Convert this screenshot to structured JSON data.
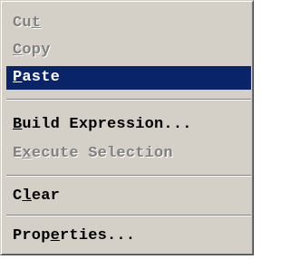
{
  "menu": {
    "items": [
      {
        "pre": "Cu",
        "key": "t",
        "post": "",
        "state": "disabled"
      },
      {
        "pre": "",
        "key": "C",
        "post": "opy",
        "state": "disabled"
      },
      {
        "pre": "",
        "key": "P",
        "post": "aste",
        "state": "highlighted"
      },
      {
        "pre": "",
        "key": "B",
        "post": "uild Expression...",
        "state": "enabled"
      },
      {
        "pre": "E",
        "key": "x",
        "post": "ecute Selection",
        "state": "disabled"
      },
      {
        "pre": "C",
        "key": "l",
        "post": "ear",
        "state": "enabled"
      },
      {
        "pre": "Prop",
        "key": "e",
        "post": "rties...",
        "state": "enabled"
      }
    ]
  },
  "colors": {
    "menu_background": "#d4d0c8",
    "highlight_background": "#0a246a",
    "highlight_text": "#ffffff",
    "disabled_text": "#808080"
  }
}
